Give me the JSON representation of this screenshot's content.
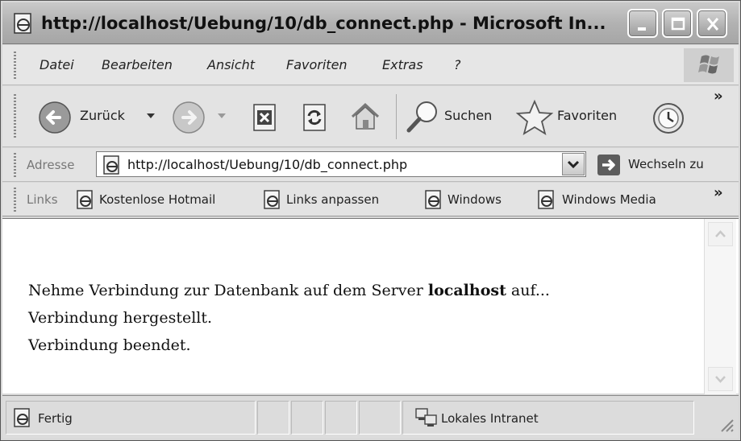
{
  "window": {
    "title": "http://localhost/Uebung/10/db_connect.php - Microsoft In..."
  },
  "menu": {
    "items": [
      "Datei",
      "Bearbeiten",
      "Ansicht",
      "Favoriten",
      "Extras",
      "?"
    ]
  },
  "toolbar": {
    "back_label": "Zurück",
    "search_label": "Suchen",
    "favorites_label": "Favoriten",
    "overflow": "»"
  },
  "address": {
    "label": "Adresse",
    "url": "http://localhost/Uebung/10/db_connect.php",
    "go_label": "Wechseln zu"
  },
  "links": {
    "label": "Links",
    "items": [
      "Kostenlose Hotmail",
      "Links anpassen",
      "Windows",
      "Windows Media"
    ],
    "overflow": "»"
  },
  "content": {
    "line1_before": "Nehme Verbindung zur Datenbank auf dem Server ",
    "line1_bold": "localhost",
    "line1_after": " auf...",
    "line2": "Verbindung hergestellt.",
    "line3": "Verbindung beendet."
  },
  "status": {
    "text": "Fertig",
    "zone": "Lokales Intranet"
  }
}
